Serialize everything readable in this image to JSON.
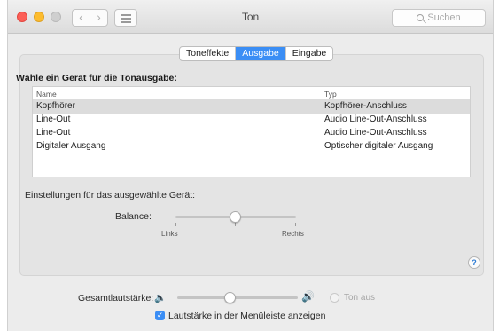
{
  "window": {
    "title": "Ton"
  },
  "toolbar": {
    "back_glyph": "‹",
    "forward_glyph": "›",
    "search_placeholder": "Suchen"
  },
  "tabs": [
    {
      "label": "Toneffekte",
      "active": false
    },
    {
      "label": "Ausgabe",
      "active": true
    },
    {
      "label": "Eingabe",
      "active": false
    }
  ],
  "output": {
    "heading": "Wähle ein Gerät für die Tonausgabe:",
    "columns": [
      "Name",
      "Typ"
    ],
    "devices": [
      {
        "name": "Kopfhörer",
        "type": "Kopfhörer-Anschluss",
        "selected": true
      },
      {
        "name": "Line-Out",
        "type": "Audio Line-Out-Anschluss",
        "selected": false
      },
      {
        "name": "Line-Out",
        "type": "Audio Line-Out-Anschluss",
        "selected": false
      },
      {
        "name": "Digitaler Ausgang",
        "type": "Optischer digitaler Ausgang",
        "selected": false
      }
    ],
    "settings_label": "Einstellungen für das ausgewählte Gerät:",
    "balance": {
      "label": "Balance:",
      "left_label": "Links",
      "right_label": "Rechts",
      "value": 0.5
    }
  },
  "help_glyph": "?",
  "volume": {
    "label": "Gesamtlautstärke:",
    "value": 0.45,
    "mute_label": "Ton aus",
    "mute_checked": false
  },
  "menubar_volume": {
    "label": "Lautstärke in der Menüleiste anzeigen",
    "checked": true
  },
  "colors": {
    "accent": "#3b8ef5",
    "close": "#fc5f57",
    "minimize": "#fdbc2e"
  }
}
